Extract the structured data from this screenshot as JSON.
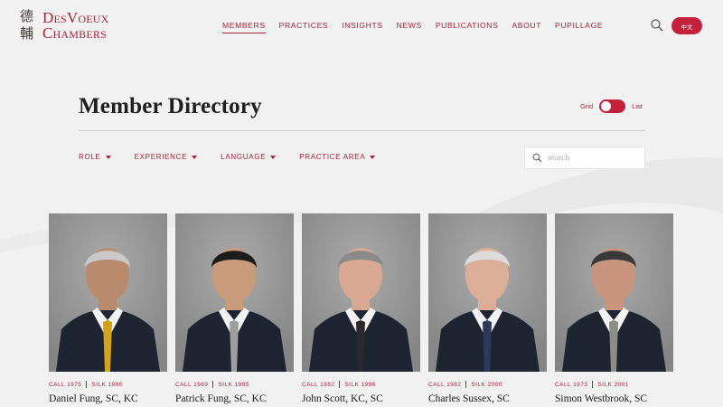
{
  "brand": {
    "logo_chars": [
      "德",
      "輔"
    ],
    "logo_line1": "DesVoeux",
    "logo_line2": "Chambers",
    "accent_color": "#a8243a",
    "button_color": "#c4203a"
  },
  "nav": {
    "items": [
      {
        "label": "MEMBERS",
        "active": true
      },
      {
        "label": "PRACTICES"
      },
      {
        "label": "INSIGHTS"
      },
      {
        "label": "NEWS"
      },
      {
        "label": "PUBLICATIONS"
      },
      {
        "label": "ABOUT"
      },
      {
        "label": "PUPILLAGE"
      }
    ],
    "search_icon": "search-icon",
    "language_label": "中文"
  },
  "directory": {
    "title": "Member Directory",
    "view_toggle": {
      "left_label": "Grid",
      "right_label": "List",
      "selected": "Grid"
    },
    "filters": [
      {
        "label": "ROLE"
      },
      {
        "label": "EXPERIENCE"
      },
      {
        "label": "LANGUAGE"
      },
      {
        "label": "PRACTICE AREA"
      }
    ],
    "search": {
      "placeholder": "search",
      "value": ""
    }
  },
  "members": [
    {
      "call": "CALL 1975",
      "silk": "SILK 1990",
      "name": "Daniel Fung, SC, KC",
      "tie": "#d3a21d",
      "hair": "#c9c9c9",
      "skin": "#b98b6c"
    },
    {
      "call": "CALL 1969",
      "silk": "SILK 1995",
      "name": "Patrick Fung, SC, KC",
      "tie": "#9e9e9e",
      "hair": "#1c1c1c",
      "skin": "#c99b7b"
    },
    {
      "call": "CALL 1982",
      "silk": "SILK 1996",
      "name": "John Scott, KC, SC",
      "tie": "#2a2a2a",
      "hair": "#8a8a8a",
      "skin": "#d8a893"
    },
    {
      "call": "CALL 1982",
      "silk": "SILK 2000",
      "name": "Charles Sussex, SC",
      "tie": "#2b3a5c",
      "hair": "#dcdcdc",
      "skin": "#dcae98"
    },
    {
      "call": "CALL 1973",
      "silk": "SILK 2001",
      "name": "Simon Westbrook, SC",
      "tie": "#8d8d84",
      "hair": "#3a3a3a",
      "skin": "#c9957e"
    }
  ]
}
